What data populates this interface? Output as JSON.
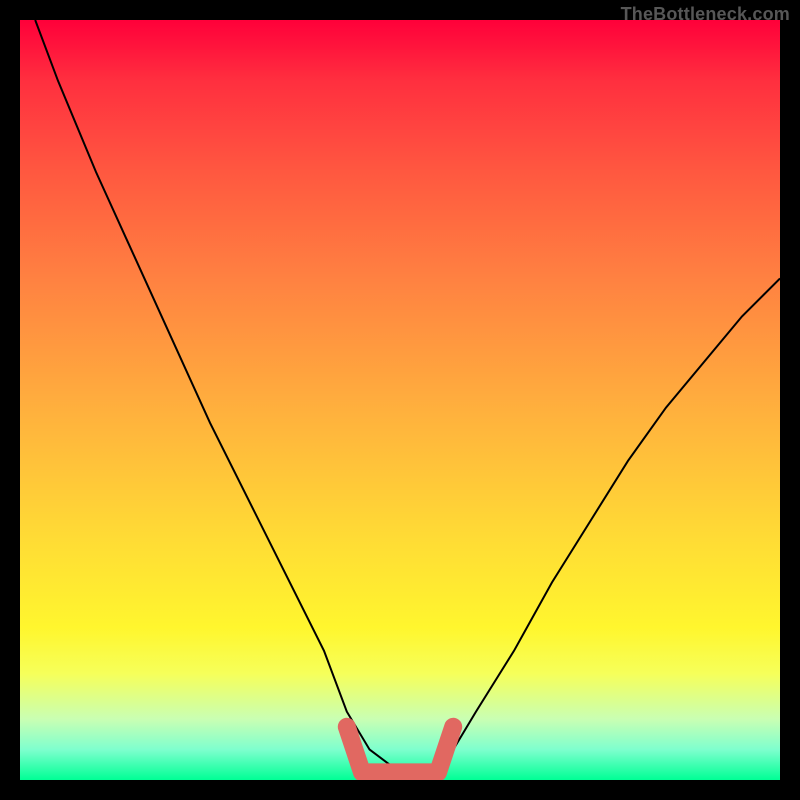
{
  "watermark": "TheBottleneck.com",
  "colors": {
    "background": "#000000",
    "curve": "#000000",
    "marker": "#e16861",
    "gradient_top": "#ff003a",
    "gradient_bottom": "#00ff95"
  },
  "chart_data": {
    "type": "line",
    "title": "",
    "xlabel": "",
    "ylabel": "",
    "xlim": [
      0,
      100
    ],
    "ylim": [
      0,
      100
    ],
    "grid": false,
    "series": [
      {
        "name": "bottleneck-curve",
        "x": [
          2,
          5,
          10,
          15,
          20,
          25,
          30,
          35,
          40,
          43,
          46,
          50,
          54,
          57,
          60,
          65,
          70,
          75,
          80,
          85,
          90,
          95,
          100
        ],
        "y": [
          100,
          92,
          80,
          69,
          58,
          47,
          37,
          27,
          17,
          9,
          4,
          1,
          1,
          4,
          9,
          17,
          26,
          34,
          42,
          49,
          55,
          61,
          66
        ]
      }
    ],
    "annotations": [
      {
        "name": "optimal-range-marker",
        "x_range": [
          43,
          57
        ],
        "y": 1,
        "color": "#e16861"
      }
    ],
    "background_gradient": {
      "orientation": "vertical",
      "stops": [
        {
          "pos": 0.0,
          "color": "#ff003a"
        },
        {
          "pos": 0.08,
          "color": "#ff2f3f"
        },
        {
          "pos": 0.2,
          "color": "#ff5840"
        },
        {
          "pos": 0.35,
          "color": "#ff8441"
        },
        {
          "pos": 0.52,
          "color": "#ffb23d"
        },
        {
          "pos": 0.68,
          "color": "#ffdb35"
        },
        {
          "pos": 0.8,
          "color": "#fff62e"
        },
        {
          "pos": 0.86,
          "color": "#f6ff5a"
        },
        {
          "pos": 0.92,
          "color": "#c9ffb3"
        },
        {
          "pos": 0.96,
          "color": "#7effce"
        },
        {
          "pos": 1.0,
          "color": "#00ff95"
        }
      ]
    }
  }
}
